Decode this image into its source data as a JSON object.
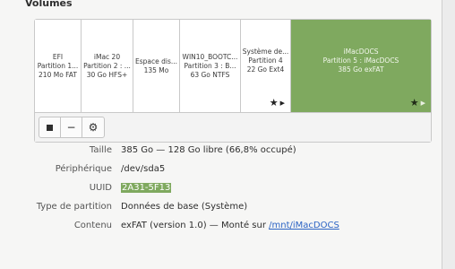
{
  "section": {
    "title": "Volumes"
  },
  "partitions": [
    {
      "lines": [
        "EFI",
        "Partition 1...",
        "210 Mo FAT"
      ]
    },
    {
      "lines": [
        "iMac 20",
        "Partition 2 : ...",
        "30 Go HFS+"
      ]
    },
    {
      "lines": [
        "Espace dis...",
        "135 Mo"
      ]
    },
    {
      "lines": [
        "WIN10_BOOTC...",
        "Partition 3 : B...",
        "63 Go NTFS"
      ]
    },
    {
      "lines": [
        "Système de...",
        "Partition 4",
        "22 Go Ext4"
      ]
    },
    {
      "lines": [
        "iMacDOCS",
        "Partition 5 : iMacDOCS",
        "385 Go exFAT"
      ]
    }
  ],
  "toolbar": {
    "icons": [
      "stop-icon",
      "minus-icon",
      "gears-icon"
    ],
    "minus_label": "−",
    "gears_label": "⚙"
  },
  "details": {
    "taille_label": "Taille",
    "taille_value": "385 Go — 128 Go libre (66,8% occupé)",
    "peripherique_label": "Périphérique",
    "peripherique_value": "/dev/sda5",
    "uuid_label": "UUID",
    "uuid_value": "2A31-5F13",
    "type_label": "Type de partition",
    "type_value": "Données de base (Système)",
    "contenu_label": "Contenu",
    "contenu_prefix": "exFAT (version 1.0) — Monté sur ",
    "contenu_link": "/mnt/iMacDOCS"
  },
  "colors": {
    "selected": "#7fa95f",
    "link": "#2b63c4"
  }
}
